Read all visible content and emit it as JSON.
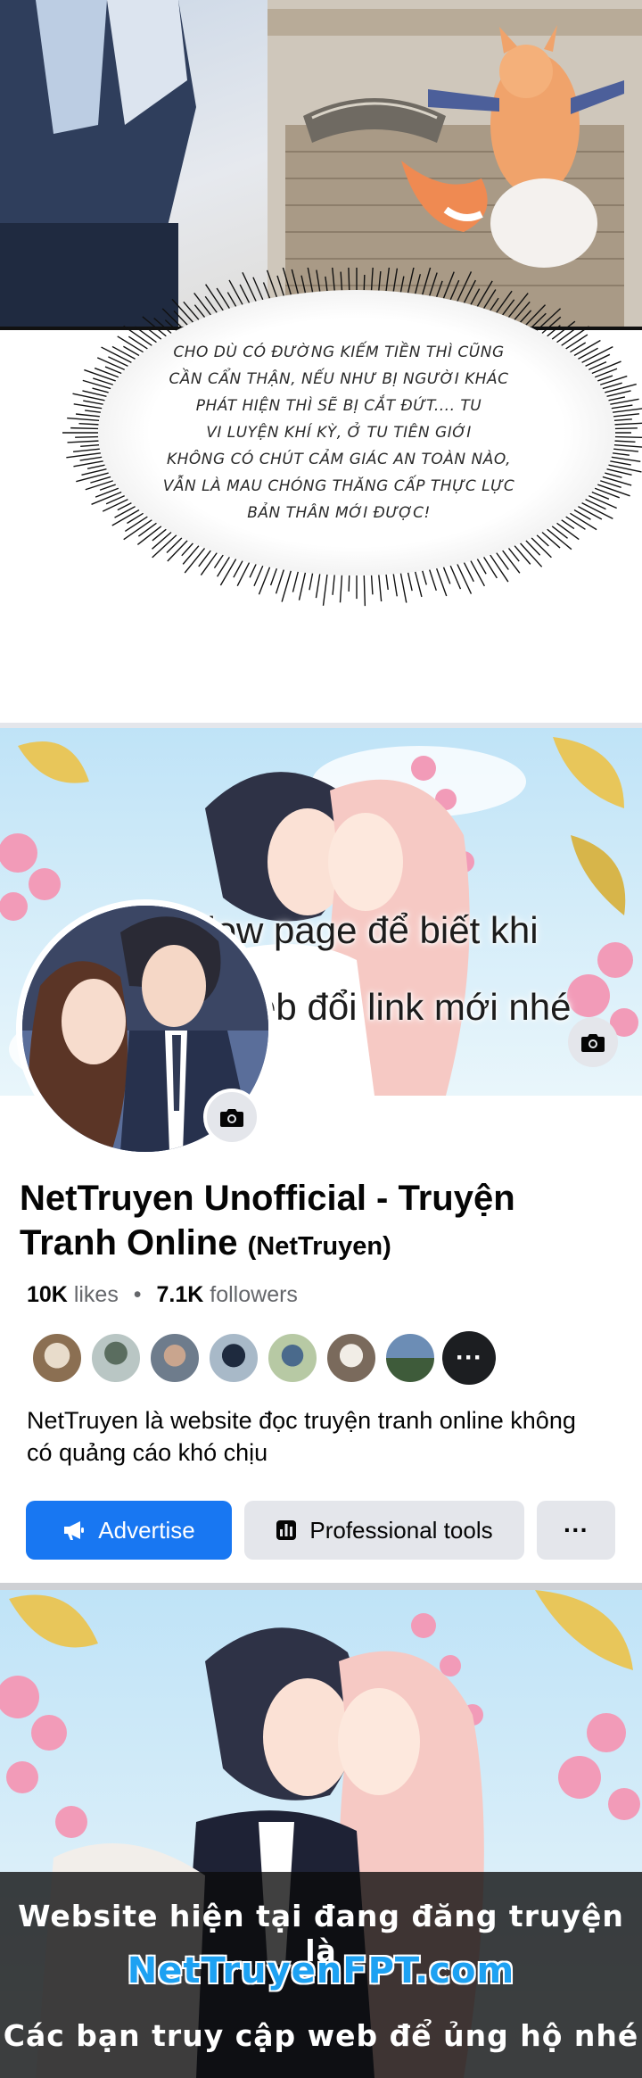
{
  "manga": {
    "speech_lines": [
      "CHO DÙ CÓ ĐƯỜNG KIẾM TIỀN THÌ CŨNG",
      "CẦN CẨN THẬN, NẾU NHƯ BỊ NGƯỜI KHÁC",
      "PHÁT HIỆN THÌ SẼ BỊ CẮT ĐỨT.... TU",
      "VI LUYỆN KHÍ KỲ, Ở TU TIÊN GIỚI",
      "KHÔNG CÓ CHÚT CẢM GIÁC AN TOÀN NÀO,",
      "VẪN LÀ MAU CHÓNG THĂNG CẤP THỰC LỰC",
      "BẢN THÂN MỚI ĐƯỢC!"
    ]
  },
  "facebook": {
    "cover_text": [
      "Follow page để biết khi",
      "nào web đổi link mới nhé"
    ],
    "page_name": "NetTruyen Unofficial - Truyện Tranh Online",
    "page_handle": "(NetTruyen)",
    "likes_count": "10K",
    "likes_label": "likes",
    "separator": "•",
    "followers_count": "7.1K",
    "followers_label": "followers",
    "more_followers": "···",
    "description": "NetTruyen là website đọc truyện tranh online không có quảng cáo khó chịu",
    "buttons": {
      "advertise": "Advertise",
      "professional_tools": "Professional tools",
      "more": "···"
    },
    "colors": {
      "primary": "#1877f2",
      "secondary_button": "#e4e6eb",
      "muted_text": "#65676b"
    },
    "icons": [
      "camera-icon",
      "megaphone-icon",
      "chart-icon"
    ]
  },
  "banner": {
    "line1": "Website hiện tại đang đăng truyện là",
    "brand": "NetTruyenFPT.com",
    "line2": "Các bạn truy cập web để ủng hộ nhé"
  }
}
